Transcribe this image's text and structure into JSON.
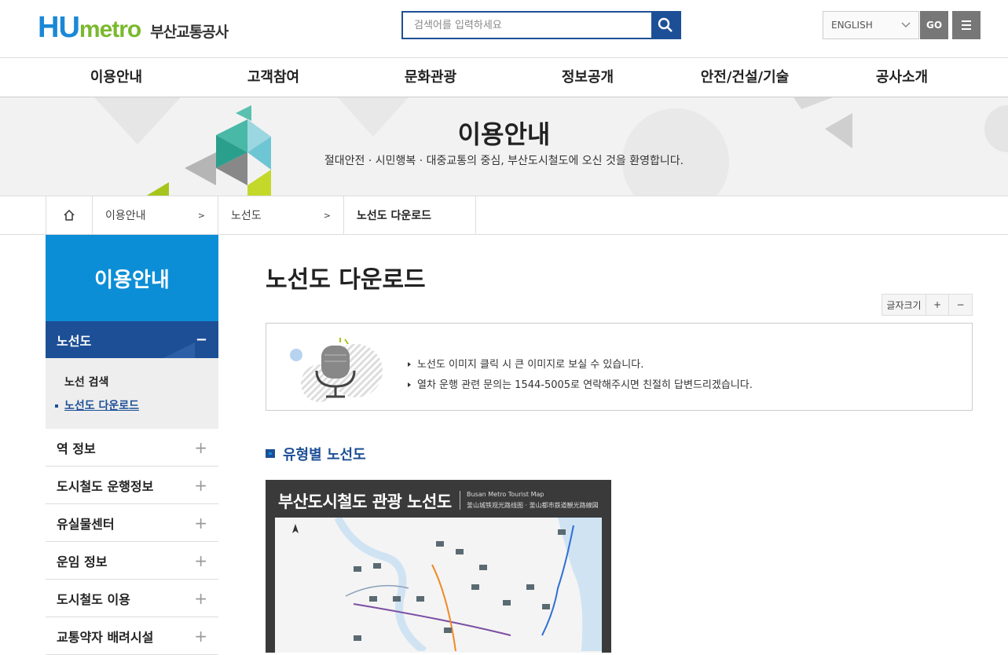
{
  "header": {
    "logo_hu": "HU",
    "logo_metro": "metro",
    "logo_kr": "부산교통공사",
    "search_placeholder": "검색어를 입력하세요",
    "lang": "ENGLISH",
    "go": "GO"
  },
  "gnb": [
    "이용안내",
    "고객참여",
    "문화관광",
    "정보공개",
    "안전/건설/기술",
    "공사소개"
  ],
  "banner": {
    "title": "이용안내",
    "subtitle": "절대안전 · 시민행복 · 대중교통의 중심, 부산도시철도에 오신 것을 환영합니다."
  },
  "breadcrumb": [
    "이용안내",
    "노선도",
    "노선도 다운로드"
  ],
  "lnb": {
    "title": "이용안내",
    "active": "노선도",
    "sub": [
      "노선 검색",
      "노선도 다운로드"
    ],
    "items": [
      "역 정보",
      "도시철도 운행정보",
      "유실물센터",
      "운임 정보",
      "도시철도 이용",
      "교통약자 배려시설"
    ]
  },
  "content": {
    "title": "노선도 다운로드",
    "fontsize_label": "글자크기",
    "fontsize_plus": "+",
    "fontsize_minus": "−",
    "info": [
      "노선도 이미지 클릭 시 큰 이미지로 보실 수 있습니다.",
      "열차 운행 관련 문의는 1544-5005로 연락해주시면 친절히 답변드리겠습니다."
    ],
    "section_title": "유형별 노선도",
    "map_title": "부산도시철도 관광 노선도",
    "map_sub1": "Busan Metro Tourist Map",
    "map_sub2": "釜山城铁观光路线图 · 釜山都市鉄道観光路線図"
  }
}
